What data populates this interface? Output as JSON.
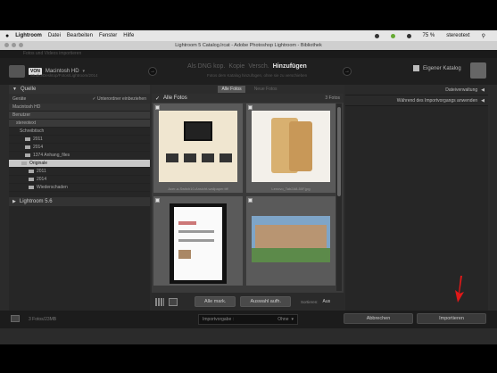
{
  "menubar": {
    "apple": "",
    "items": [
      "Lightroom",
      "Datei",
      "Bearbeiten",
      "Fenster",
      "Hilfe"
    ],
    "battery": "75 %",
    "user": "stereotext"
  },
  "window": {
    "title": "Lightroom 5 Catalog.lrcat - Adobe Photoshop Lightroom - Bibliothek",
    "subtitle": "Fotos und Videos importieren"
  },
  "import_header": {
    "source_badge": "VON",
    "source_name": "Macintosh HD",
    "source_sub": "Studio/Desktop/Fotos/Lightroom/2014",
    "modes": [
      "Als DNG kop.",
      "Kopie",
      "Versch.",
      "Hinzufügen"
    ],
    "active_mode": "Hinzufügen",
    "modes_sub": "Fotos dem Katalog hinzufügen, ohne sie zu verschieben",
    "destination": "Eigener Katalog"
  },
  "left_panel": {
    "header": "Quelle",
    "search_label": "Geräte",
    "search_option": "Unterordner einbeziehen",
    "items": [
      {
        "label": "Macintosh HD",
        "style": "grey"
      },
      {
        "label": "Benutzer",
        "style": "hl"
      },
      {
        "label": "stereotext",
        "style": "hl"
      },
      {
        "label": "Schreibtisch",
        "style": "normal"
      },
      {
        "label": "2011",
        "style": "normal"
      },
      {
        "label": "2014",
        "style": "normal"
      },
      {
        "label": "1374 Anhang_files",
        "style": "normal"
      },
      {
        "label": "Originale",
        "style": "sel"
      },
      {
        "label": "2011",
        "style": "normal"
      },
      {
        "label": "2014",
        "style": "normal"
      },
      {
        "label": "Wiederschaden",
        "style": "normal"
      }
    ],
    "footer_item": "Lightroom 5.6"
  },
  "center": {
    "tabs": [
      "Alle Fotos",
      "Neue Fotos"
    ],
    "active_tab": "Alle Fotos",
    "header": "Alle Fotos",
    "count": "3 Fotos",
    "thumbnails": [
      {
        "caption": "Acer-a-Switch10-Ansicht-wallpaper.tiff"
      },
      {
        "caption": "Lenovo_Tab2A8-50F.jpg"
      },
      {
        "caption": ""
      },
      {
        "caption": ""
      }
    ],
    "toolbar": {
      "check_all": "Alle mark.",
      "uncheck_all": "Auswahl aufh.",
      "sort_label": "Sortieren:",
      "sort_value": "Aus"
    }
  },
  "right_panel": {
    "rows": [
      "Dateiverwaltung",
      "Während des Importvorgangs anwenden"
    ]
  },
  "bottom": {
    "summary": "3 Fotos/23MB",
    "preset_label": "Importvorgabe :",
    "preset_value": "Ohne",
    "cancel": "Abbrechen",
    "import": "Importieren"
  },
  "colors": {
    "annotation_arrow": "#e01818"
  }
}
